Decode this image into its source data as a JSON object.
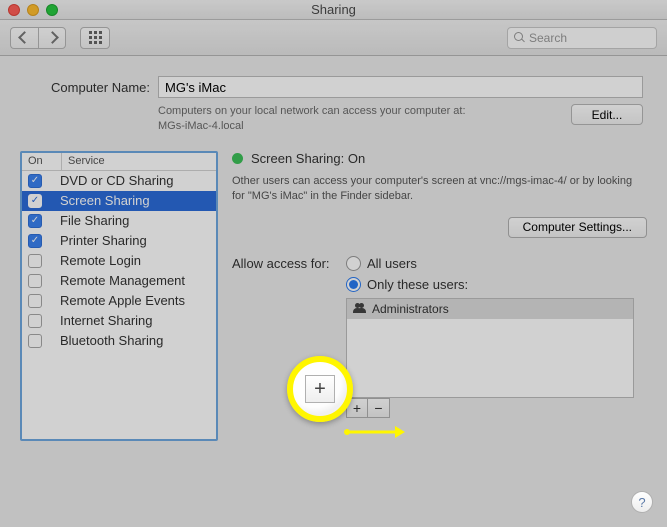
{
  "window": {
    "title": "Sharing",
    "search_placeholder": "Search"
  },
  "computer_name": {
    "label": "Computer Name:",
    "value": "MG's iMac",
    "desc_line1": "Computers on your local network can access your computer at:",
    "desc_line2": "MGs-iMac-4.local",
    "edit_label": "Edit..."
  },
  "services": {
    "header_on": "On",
    "header_service": "Service",
    "items": [
      {
        "label": "DVD or CD Sharing",
        "on": true,
        "selected": false
      },
      {
        "label": "Screen Sharing",
        "on": true,
        "selected": true
      },
      {
        "label": "File Sharing",
        "on": true,
        "selected": false
      },
      {
        "label": "Printer Sharing",
        "on": true,
        "selected": false
      },
      {
        "label": "Remote Login",
        "on": false,
        "selected": false
      },
      {
        "label": "Remote Management",
        "on": false,
        "selected": false
      },
      {
        "label": "Remote Apple Events",
        "on": false,
        "selected": false
      },
      {
        "label": "Internet Sharing",
        "on": false,
        "selected": false
      },
      {
        "label": "Bluetooth Sharing",
        "on": false,
        "selected": false
      }
    ]
  },
  "detail": {
    "status_label": "Screen Sharing: On",
    "status_color": "#3cc058",
    "info_text": "Other users can access your computer's screen at vnc://mgs-imac-4/ or by looking for \"MG's iMac\" in the Finder sidebar.",
    "computer_settings_label": "Computer Settings...",
    "access_label": "Allow access for:",
    "radio_all": "All users",
    "radio_only": "Only these users:",
    "selected_radio": "only",
    "users": [
      {
        "name": "Administrators"
      }
    ],
    "add_symbol": "+",
    "remove_symbol": "−",
    "help_symbol": "?"
  }
}
